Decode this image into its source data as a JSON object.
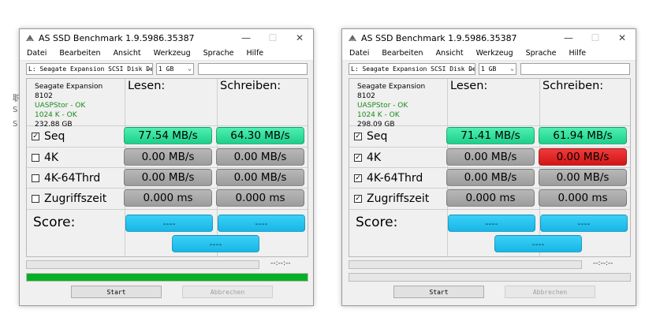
{
  "windows": [
    {
      "title": "AS SSD Benchmark 1.9.5986.35387",
      "menu": [
        "Datei",
        "Bearbeiten",
        "Ansicht",
        "Werkzeug",
        "Sprache",
        "Hilfe"
      ],
      "drive_select": "L: Seagate Expansion SCSI Disk De",
      "size_select": "1 GB",
      "drive_info": {
        "name": "Seagate Expansion",
        "model": "8102",
        "driver": "UASPStor - OK",
        "alignment": "1024 K - OK",
        "capacity": "232.88 GB"
      },
      "col_read": "Lesen:",
      "col_write": "Schreiben:",
      "tests": [
        {
          "label": "Seq",
          "checked": true,
          "read": "77.54 MB/s",
          "write": "64.30 MB/s",
          "read_color": "green",
          "write_color": "green"
        },
        {
          "label": "4K",
          "checked": false,
          "read": "0.00 MB/s",
          "write": "0.00 MB/s",
          "read_color": "gray",
          "write_color": "gray"
        },
        {
          "label": "4K-64Thrd",
          "checked": false,
          "read": "0.00 MB/s",
          "write": "0.00 MB/s",
          "read_color": "gray",
          "write_color": "gray"
        },
        {
          "label": "Zugriffszeit",
          "checked": false,
          "read": "0.000 ms",
          "write": "0.000 ms",
          "read_color": "gray",
          "write_color": "gray"
        }
      ],
      "score_label": "Score:",
      "score_read": "----",
      "score_write": "----",
      "score_total": "----",
      "timer": "--:--:--",
      "progress": 1.0,
      "start_label": "Start",
      "abort_label": "Abbrechen"
    },
    {
      "title": "AS SSD Benchmark 1.9.5986.35387",
      "menu": [
        "Datei",
        "Bearbeiten",
        "Ansicht",
        "Werkzeug",
        "Sprache",
        "Hilfe"
      ],
      "drive_select": "L: Seagate Expansion SCSI Disk De",
      "size_select": "1 GB",
      "drive_info": {
        "name": "Seagate Expansion",
        "model": "8102",
        "driver": "UASPStor - OK",
        "alignment": "1024 K - OK",
        "capacity": "298.09 GB"
      },
      "col_read": "Lesen:",
      "col_write": "Schreiben:",
      "tests": [
        {
          "label": "Seq",
          "checked": true,
          "read": "71.41 MB/s",
          "write": "61.94 MB/s",
          "read_color": "green",
          "write_color": "green"
        },
        {
          "label": "4K",
          "checked": true,
          "read": "0.00 MB/s",
          "write": "0.00 MB/s",
          "read_color": "gray",
          "write_color": "red"
        },
        {
          "label": "4K-64Thrd",
          "checked": true,
          "read": "0.00 MB/s",
          "write": "0.00 MB/s",
          "read_color": "gray",
          "write_color": "gray"
        },
        {
          "label": "Zugriffszeit",
          "checked": true,
          "read": "0.000 ms",
          "write": "0.000 ms",
          "read_color": "gray",
          "write_color": "gray"
        }
      ],
      "score_label": "Score:",
      "score_read": "----",
      "score_write": "----",
      "score_total": "----",
      "timer": "--:--:--",
      "progress": 0.0,
      "start_label": "Start",
      "abort_label": "Abbrechen"
    }
  ],
  "colors": {
    "green": "#2ee09c",
    "gray": "#aaaaaa",
    "red": "#e22222",
    "score": "#22c0ee",
    "progress": "#06b025"
  },
  "bg_fragments": [
    "职",
    "S",
    "S"
  ]
}
